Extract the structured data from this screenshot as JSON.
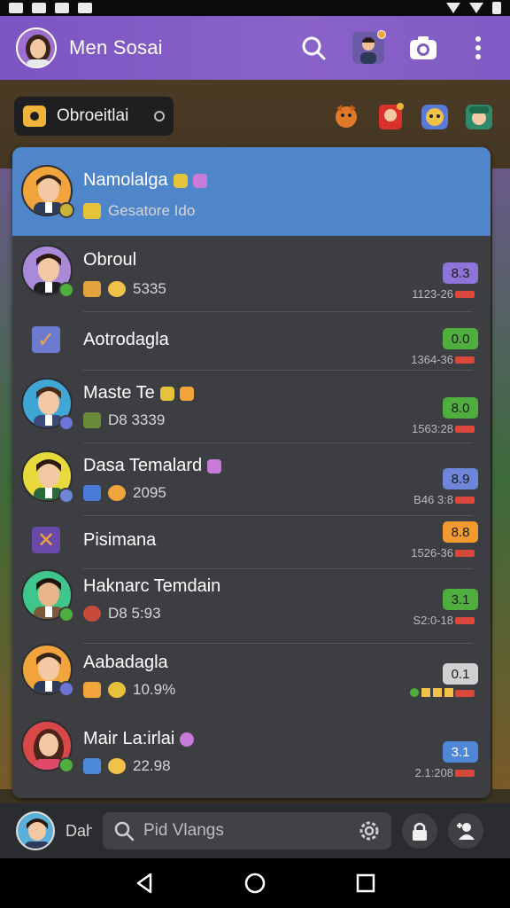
{
  "app": {
    "title": "Men Sosai"
  },
  "filter": {
    "label": "Obroeitlai"
  },
  "conversations": [
    {
      "name": "Namolalga",
      "sub": "Gesatore Ido",
      "time": "",
      "badge": "",
      "selected": true,
      "kind": "contact",
      "avatar_bg": "#f2a43c",
      "badge_color": ""
    },
    {
      "name": "Obroul",
      "sub": "5335",
      "time": "1123-26",
      "badge": "8.3",
      "selected": false,
      "kind": "contact",
      "avatar_bg": "#a88ad8",
      "badge_color": "#8e74d8"
    },
    {
      "name": "Aotrodagla",
      "sub": "",
      "time": "1364-36",
      "badge": "0.0",
      "selected": false,
      "kind": "check",
      "avatar_bg": "",
      "badge_color": "#4fae3e"
    },
    {
      "name": "Maste Te",
      "sub": "D8 3339",
      "time": "1563:28",
      "badge": "8.0",
      "selected": false,
      "kind": "contact",
      "avatar_bg": "#3fa6d6",
      "badge_color": "#4fae3e"
    },
    {
      "name": "Dasa Temalard",
      "sub": "2095",
      "time": "B46 3:8",
      "badge": "8.9",
      "selected": false,
      "kind": "contact",
      "avatar_bg": "#e8d93c",
      "badge_color": "#6d86d8"
    },
    {
      "name": "Pisimana",
      "sub": "",
      "time": "1526-36",
      "badge": "8.8",
      "selected": false,
      "kind": "cross",
      "avatar_bg": "",
      "badge_color": "#f09a30"
    },
    {
      "name": "Haknarc Temdain",
      "sub": "D8 5:93",
      "time": "S2:0-18",
      "badge": "3.1",
      "selected": false,
      "kind": "contact",
      "avatar_bg": "#3fc68c",
      "badge_color": "#4fae3e"
    },
    {
      "name": "Aabadagla",
      "sub": "10.9%",
      "time": "",
      "badge": "0.1",
      "selected": false,
      "kind": "contact",
      "avatar_bg": "#f2a43c",
      "badge_color": "#d0d0d0"
    },
    {
      "name": "Mair La:irlai",
      "sub": "22.98",
      "time": "2.1:208",
      "badge": "3.1",
      "selected": false,
      "kind": "contact",
      "avatar_bg": "#d84848",
      "badge_color": "#4f86d8"
    }
  ],
  "bottom": {
    "label": "Dah",
    "search_placeholder": "Pid Vlangs"
  },
  "icons": {
    "search": "search-icon",
    "camera": "camera-icon",
    "menu": "more-vert-icon",
    "settings": "gear-icon",
    "lock": "lock-icon",
    "contact": "person-add-icon"
  }
}
